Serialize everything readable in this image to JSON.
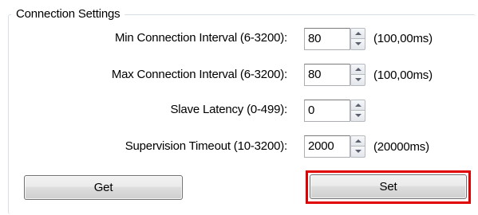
{
  "group": {
    "title": "Connection Settings"
  },
  "rows": [
    {
      "label": "Min Connection Interval (6-3200):",
      "value": "80",
      "unit": "(100,00ms)"
    },
    {
      "label": "Max Connection Interval (6-3200):",
      "value": "80",
      "unit": "(100,00ms)"
    },
    {
      "label": "Slave Latency (0-499):",
      "value": "0",
      "unit": ""
    },
    {
      "label": "Supervision Timeout (10-3200):",
      "value": "2000",
      "unit": "(20000ms)"
    }
  ],
  "buttons": {
    "get_label": "Get",
    "set_label": "Set"
  },
  "colors": {
    "highlight": "#e00000",
    "group_border": "#d5dfe5",
    "field_border": "#abadb3"
  },
  "icons": {
    "spinner_up": "chevron-up-icon",
    "spinner_down": "chevron-down-icon"
  }
}
